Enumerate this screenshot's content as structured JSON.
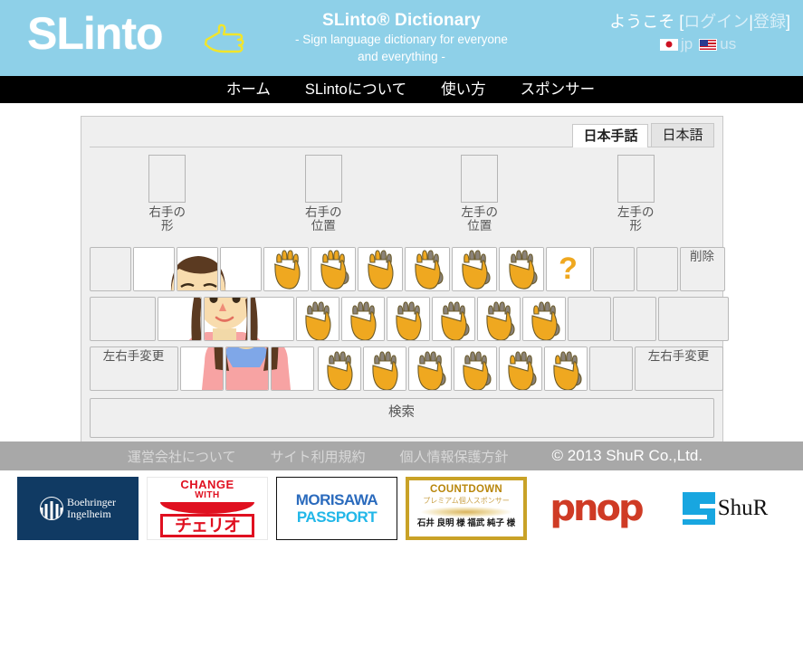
{
  "header": {
    "logo_text": "SLinto",
    "logo_icon": "pointing-hand-icon",
    "title": "SLinto® Dictionary",
    "subtitle_line1": "- Sign language dictionary for everyone",
    "subtitle_line2": "and everything -",
    "welcome_prefix": "ようこそ [",
    "login_label": "ログイン",
    "separator": "|",
    "register_label": "登録",
    "welcome_suffix": "]",
    "lang_jp": "jp",
    "lang_us": "us",
    "bg_color": "#8ed0e8"
  },
  "nav": {
    "items": [
      {
        "label": "ホーム"
      },
      {
        "label": "SLintoについて"
      },
      {
        "label": "使い方"
      },
      {
        "label": "スポンサー"
      }
    ],
    "bg_color": "#000000"
  },
  "search_panel": {
    "tabs": [
      {
        "label": "日本手話",
        "active": true
      },
      {
        "label": "日本語",
        "active": false
      }
    ],
    "slots": [
      {
        "label_line1": "右手の",
        "label_line2": "形",
        "value": ""
      },
      {
        "label_line1": "右手の",
        "label_line2": "位置",
        "value": ""
      },
      {
        "label_line1": "左手の",
        "label_line2": "位置",
        "value": ""
      },
      {
        "label_line1": "左手の",
        "label_line2": "形",
        "value": ""
      }
    ],
    "delete_label": "削除",
    "swap_hands_label_left": "左右手変更",
    "swap_hands_label_right": "左右手変更",
    "question_mark": "?",
    "search_label": "検索",
    "accent_color": "#efa820"
  },
  "footer": {
    "links": [
      {
        "label": "運営会社について"
      },
      {
        "label": "サイト利用規約"
      },
      {
        "label": "個人情報保護方針"
      }
    ],
    "copyright": "© 2013 ShuR Co.,Ltd.",
    "bg_color": "#a8a8a8"
  },
  "sponsors": [
    {
      "name": "Boehringer Ingelheim",
      "line1": "Boehringer",
      "line2": "Ingelheim"
    },
    {
      "name": "Cheerio",
      "line1": "CHANGE",
      "line2": "WITH",
      "line3": "チェリオ"
    },
    {
      "name": "Morisawa Passport",
      "line1": "MORISAWA",
      "line2": "PASSPORT"
    },
    {
      "name": "Countdown Premium Sponsor",
      "line1": "COUNTDOWN",
      "line2": "プレミアム個人スポンサー",
      "line3": "石井 良明 様  福武 純子 様"
    },
    {
      "name": "pnop",
      "line1": "pnop"
    },
    {
      "name": "ShuR",
      "line1": "ShuR"
    }
  ]
}
